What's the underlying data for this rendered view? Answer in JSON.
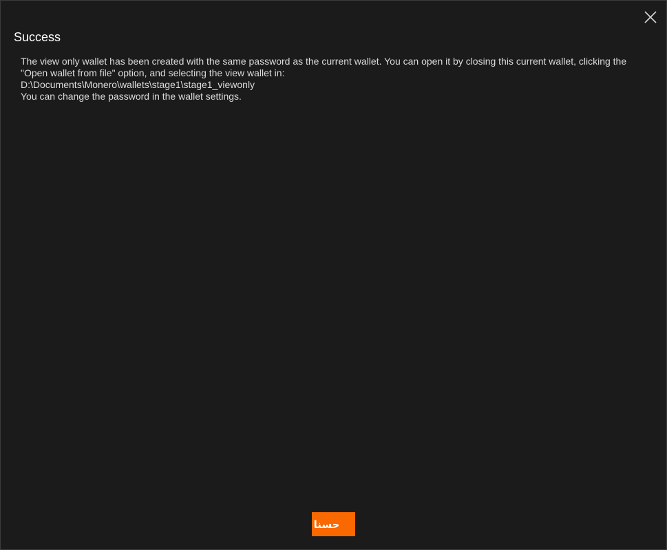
{
  "dialog": {
    "title": "Success",
    "message_lines": [
      "The view only wallet has been created with the same password as the current wallet. You can open it by closing this current wallet, clicking the \"Open wallet from file\" option, and selecting the view wallet in:",
      "D:\\Documents\\Monero\\wallets\\stage1\\stage1_viewonly",
      "You can change the password in the wallet settings."
    ],
    "ok_label": "حسنا",
    "close_icon": "close-icon"
  },
  "colors": {
    "background": "#1b1b1b",
    "accent": "#fa6800",
    "text": "#dcdcdc"
  }
}
